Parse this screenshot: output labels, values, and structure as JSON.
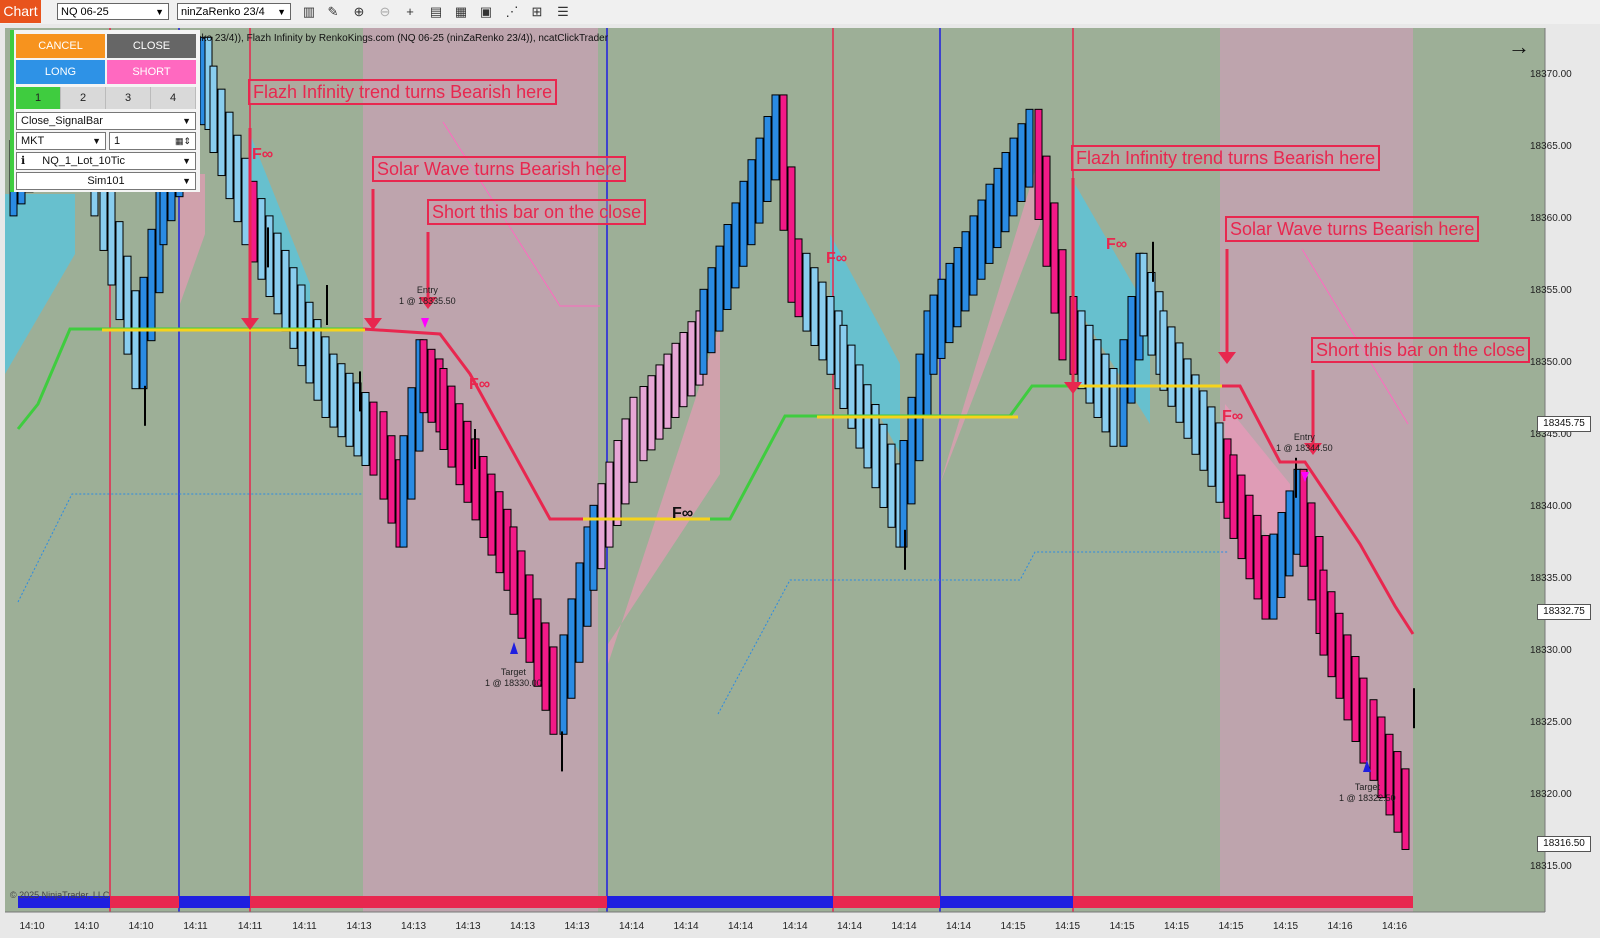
{
  "toolbar": {
    "tab_label": "Chart",
    "instrument": "NQ 06-25",
    "bar_type": "ninZaRenko 23/4",
    "icons": [
      "bars-icon",
      "pencil-icon",
      "zoom-in-icon",
      "zoom-out-icon",
      "crosshair-icon",
      "properties-icon",
      "templates-icon",
      "indicators-icon",
      "strategies-icon",
      "data-box-icon",
      "menu-list-icon"
    ]
  },
  "chart": {
    "title": "nko 23/4)), Flazh Infinity by RenkoKings.com (NQ 06-25 (ninZaRenko 23/4)), ncatClickTrader",
    "copyright": "© 2025 NinjaTrader, LLC",
    "colors": {
      "bull_bar": "#2a8be3",
      "bull_light": "#89cdee",
      "bear_bar": "#f21a87",
      "bear_light": "#e6a6d6",
      "zone_green": "#9daf97",
      "zone_pink": "#bea4ad",
      "trend_line_red": "#e8274f",
      "trend_line_green": "#3fcc3f",
      "entry_line": "#f6d31b"
    }
  },
  "trade_panel": {
    "cancel": "CANCEL",
    "close": "CLOSE",
    "long": "LONG",
    "short": "SHORT",
    "atm_tabs": [
      "1",
      "2",
      "3",
      "4"
    ],
    "exit_mode": "Close_SignalBar",
    "order_type": "MKT",
    "quantity": "1",
    "atm_template": "NQ_1_Lot_10Tic",
    "account": "Sim101"
  },
  "annotations": [
    {
      "id": "flazh-1",
      "text": "Flazh Infinity trend turns Bearish here"
    },
    {
      "id": "solar-1",
      "text": "Solar Wave turns Bearish here"
    },
    {
      "id": "short-1",
      "text": "Short this bar on the close"
    },
    {
      "id": "flazh-2",
      "text": "Flazh Infinity trend turns Bearish here"
    },
    {
      "id": "solar-2",
      "text": "Solar Wave turns Bearish here"
    },
    {
      "id": "short-2",
      "text": "Short this bar on the close"
    }
  ],
  "orders": {
    "entry1_title": "Entry",
    "entry1_value": "1 @ 18335.50",
    "target1_title": "Target",
    "target1_value": "1 @ 18330.00",
    "entry2_title": "Entry",
    "entry2_value": "1 @ 18344.50",
    "target2_title": "Target",
    "target2_value": "1 @ 18322.50"
  },
  "fl_marker": "F∞",
  "price_axis": {
    "labels": [
      "18370.00",
      "18365.00",
      "18360.00",
      "18355.00",
      "18350.00",
      "18345.00",
      "18340.00",
      "18335.00",
      "18330.00",
      "18325.00",
      "18320.00",
      "18315.00"
    ],
    "tags": [
      "18345.75",
      "18332.75",
      "18316.50"
    ]
  },
  "time_axis": {
    "labels": [
      "14:10",
      "14:10",
      "14:10",
      "14:11",
      "14:11",
      "14:11",
      "14:13",
      "14:13",
      "14:13",
      "14:13",
      "14:13",
      "14:14",
      "14:14",
      "14:14",
      "14:14",
      "14:14",
      "14:14",
      "14:14",
      "14:15",
      "14:15",
      "14:15",
      "14:15",
      "14:15",
      "14:15",
      "14:16",
      "14:16"
    ]
  }
}
